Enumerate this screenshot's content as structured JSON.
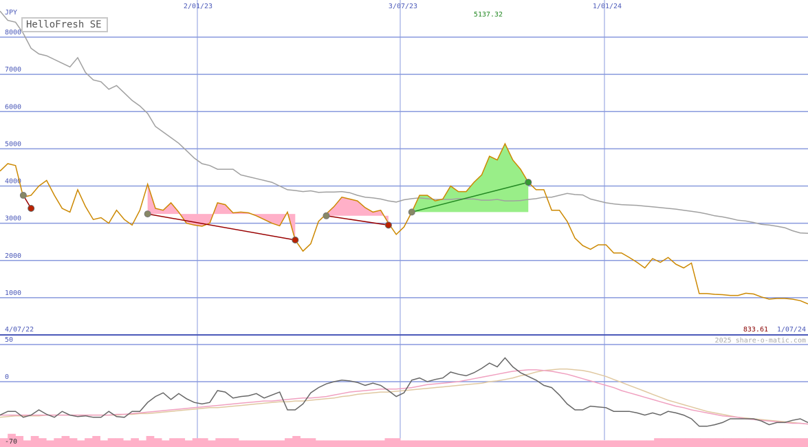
{
  "chart_title": "HelloFresh SE",
  "currency_label": "JPY",
  "copyright": "2025 share-o-matic.com",
  "colors": {
    "price": "#cc8800",
    "average": "#a0a0a0",
    "grid": "#8899dd",
    "gain_fill": "#99ee88",
    "loss_fill": "#ffb0c8",
    "loss_trend": "#990000",
    "gain_trend": "#228822",
    "osc_main": "#666666",
    "osc_pink": "#f0a0c0",
    "osc_tan": "#e0c8a0",
    "volume": "#ffb0c8"
  },
  "chart_data": [
    {
      "type": "line",
      "title": "HelloFresh SE",
      "ylabel": "JPY",
      "x_start": "4/07/22",
      "x_end": "1/07/24",
      "x_tick_labels": [
        "2/01/23",
        "3/07/23",
        "1/01/24"
      ],
      "y_tick_labels": [
        "1000",
        "2000",
        "3000",
        "4000",
        "5000",
        "6000",
        "7000",
        "8000"
      ],
      "ylim": [
        0,
        8500
      ],
      "grid": true,
      "max_label": "5137.32",
      "last_label": "833.61",
      "series": [
        {
          "values": [
            4400,
            4600,
            4550,
            3700,
            3750,
            4000,
            4150,
            3750,
            3400,
            3300,
            3900,
            3450,
            3100,
            3150,
            3000,
            3350,
            3100,
            2950,
            3350,
            4050,
            3400,
            3350,
            3550,
            3300,
            3000,
            2950,
            2920,
            3000,
            3550,
            3500,
            3280,
            3300,
            3280,
            3200,
            3100,
            3000,
            2930,
            3300,
            2550,
            2250,
            2450,
            3050,
            3250,
            3450,
            3700,
            3650,
            3600,
            3420,
            3300,
            3350,
            3000,
            2700,
            2900,
            3300,
            3750,
            3750,
            3600,
            3650,
            4000,
            3850,
            3850,
            4100,
            4300,
            4800,
            4700,
            5137,
            4700,
            4450,
            4100,
            3900,
            3900,
            3350,
            3350,
            3050,
            2600,
            2400,
            2300,
            2420,
            2420,
            2200,
            2200,
            2080,
            1950,
            1800,
            2050,
            1950,
            2080,
            1900,
            1800,
            1930,
            1110,
            1110,
            1090,
            1080,
            1060,
            1060,
            1120,
            1100,
            1020,
            960,
            980,
            980,
            960,
            920,
            834
          ]
        },
        {
          "values": [
            8700,
            8450,
            8400,
            8100,
            7700,
            7550,
            7500,
            7400,
            7300,
            7200,
            7450,
            7050,
            6850,
            6800,
            6600,
            6700,
            6500,
            6300,
            6150,
            5950,
            5600,
            5450,
            5300,
            5150,
            4950,
            4750,
            4600,
            4550,
            4450,
            4450,
            4450,
            4300,
            4250,
            4200,
            4150,
            4100,
            4000,
            3900,
            3880,
            3850,
            3870,
            3830,
            3840,
            3840,
            3850,
            3820,
            3750,
            3700,
            3680,
            3650,
            3600,
            3570,
            3630,
            3660,
            3680,
            3660,
            3640,
            3640,
            3640,
            3660,
            3650,
            3650,
            3620,
            3620,
            3640,
            3600,
            3600,
            3610,
            3640,
            3660,
            3700,
            3700,
            3750,
            3800,
            3770,
            3760,
            3650,
            3600,
            3550,
            3520,
            3500,
            3490,
            3480,
            3460,
            3440,
            3420,
            3400,
            3380,
            3350,
            3320,
            3290,
            3250,
            3200,
            3170,
            3130,
            3080,
            3060,
            3020,
            2970,
            2950,
            2920,
            2880,
            2800,
            2740,
            2730
          ]
        }
      ],
      "trend_segments": [
        {
          "from": [
            3,
            3750
          ],
          "to": [
            4,
            3400
          ],
          "kind": "loss"
        },
        {
          "from": [
            19,
            3250
          ],
          "to": [
            38,
            2550
          ],
          "kind": "loss"
        },
        {
          "from": [
            42,
            3200
          ],
          "to": [
            50,
            2950
          ],
          "kind": "loss"
        },
        {
          "from": [
            53,
            3300
          ],
          "to": [
            68,
            4100
          ],
          "kind": "gain"
        }
      ]
    },
    {
      "type": "line",
      "title": "",
      "y_tick_labels": [
        "50",
        "0",
        "-70"
      ],
      "ylim": [
        -70,
        50
      ],
      "grid": true,
      "series": [
        {
          "values": [
            -45,
            -40,
            -40,
            -48,
            -45,
            -38,
            -44,
            -48,
            -40,
            -45,
            -47,
            -46,
            -48,
            -48,
            -40,
            -47,
            -48,
            -40,
            -40,
            -28,
            -20,
            -15,
            -24,
            -16,
            -23,
            -28,
            -30,
            -28,
            -12,
            -14,
            -22,
            -20,
            -19,
            -16,
            -22,
            -18,
            -14,
            -38,
            -38,
            -30,
            -15,
            -8,
            -3,
            0,
            2,
            1,
            -1,
            -5,
            -2,
            -5,
            -12,
            -20,
            -15,
            2,
            5,
            0,
            3,
            5,
            13,
            10,
            8,
            12,
            18,
            25,
            20,
            32,
            20,
            12,
            7,
            2,
            -5,
            -8,
            -18,
            -30,
            -38,
            -38,
            -33,
            -34,
            -35,
            -40,
            -40,
            -40,
            -42,
            -45,
            -42,
            -45,
            -40,
            -42,
            -45,
            -50,
            -60,
            -60,
            -58,
            -55,
            -50,
            -50,
            -50,
            -50,
            -53,
            -58,
            -55,
            -55,
            -52,
            -50,
            -55
          ]
        },
        {
          "values": [
            -45,
            -45,
            -45,
            -45,
            -45,
            -45,
            -45,
            -45,
            -45,
            -45,
            -45,
            -45,
            -45,
            -45,
            -45,
            -44,
            -44,
            -43,
            -42,
            -41,
            -40,
            -39,
            -38,
            -37,
            -36,
            -35,
            -34,
            -33,
            -32,
            -31,
            -30,
            -29,
            -28,
            -27,
            -26,
            -26,
            -25,
            -24,
            -23,
            -22,
            -22,
            -21,
            -20,
            -18,
            -16,
            -14,
            -13,
            -12,
            -11,
            -10,
            -10,
            -10,
            -9,
            -8,
            -6,
            -4,
            -3,
            -2,
            -1,
            0,
            2,
            4,
            6,
            8,
            10,
            12,
            14,
            15,
            16,
            16,
            15,
            14,
            12,
            10,
            7,
            4,
            1,
            -2,
            -5,
            -8,
            -12,
            -15,
            -18,
            -21,
            -24,
            -27,
            -30,
            -33,
            -35,
            -38,
            -40,
            -42,
            -44,
            -46,
            -47,
            -48,
            -50,
            -51,
            -52,
            -53,
            -54,
            -55,
            -56,
            -56,
            -57
          ]
        },
        {
          "values": [
            -48,
            -47,
            -46,
            -46,
            -46,
            -46,
            -45,
            -45,
            -45,
            -45,
            -45,
            -45,
            -45,
            -45,
            -45,
            -45,
            -44,
            -44,
            -43,
            -43,
            -42,
            -41,
            -40,
            -39,
            -38,
            -37,
            -36,
            -35,
            -35,
            -34,
            -33,
            -32,
            -31,
            -30,
            -29,
            -28,
            -27,
            -27,
            -26,
            -26,
            -25,
            -24,
            -23,
            -22,
            -20,
            -19,
            -17,
            -16,
            -15,
            -14,
            -14,
            -13,
            -12,
            -11,
            -10,
            -9,
            -8,
            -7,
            -6,
            -5,
            -4,
            -3,
            -2,
            0,
            1,
            3,
            5,
            8,
            10,
            13,
            15,
            16,
            17,
            17,
            16,
            15,
            13,
            10,
            7,
            3,
            -1,
            -5,
            -9,
            -13,
            -17,
            -21,
            -25,
            -28,
            -31,
            -34,
            -37,
            -40,
            -42,
            -44,
            -46,
            -48,
            -49,
            -50,
            -51,
            -52,
            -53,
            -54,
            -55,
            -56,
            -57
          ]
        }
      ],
      "volume": [
        4,
        6,
        5,
        3,
        5,
        4,
        3,
        4,
        5,
        4,
        3,
        4,
        5,
        3,
        4,
        4,
        3,
        4,
        3,
        5,
        4,
        3,
        4,
        4,
        3,
        4,
        4,
        3,
        4,
        4,
        4,
        3,
        3,
        3,
        3,
        3,
        3,
        4,
        5,
        4,
        4,
        3,
        3,
        3,
        3,
        3,
        3,
        3,
        3,
        3,
        4,
        4,
        3,
        3,
        3,
        3,
        3,
        3,
        3,
        3,
        3,
        3,
        3,
        3,
        3,
        3,
        3,
        3,
        3,
        3,
        3,
        3,
        3,
        3,
        3,
        3,
        3,
        3,
        3,
        3,
        3,
        3,
        3,
        3,
        3,
        4,
        4,
        4,
        4,
        4,
        4,
        4,
        4,
        4,
        4,
        4,
        4,
        4,
        4,
        4,
        4,
        4,
        4,
        4,
        4
      ]
    }
  ]
}
